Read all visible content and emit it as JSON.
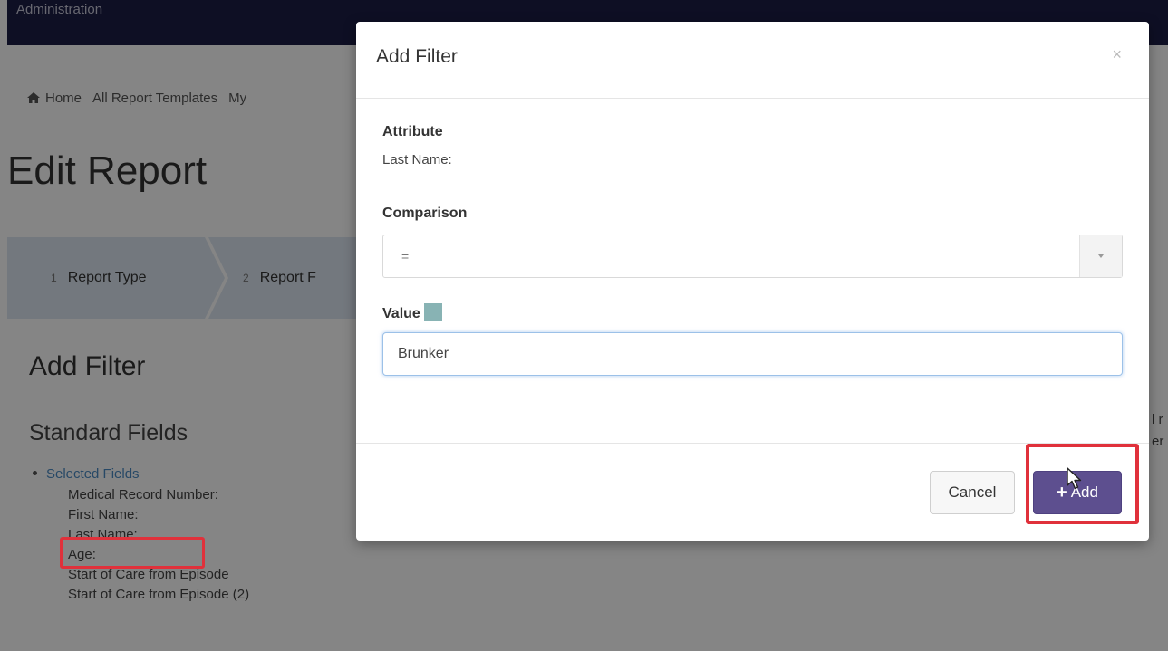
{
  "topbar": {
    "title": "Administration"
  },
  "breadcrumb": {
    "items": [
      {
        "label": "Home",
        "icon": "home-icon"
      },
      {
        "label": "All Report Templates"
      },
      {
        "label": "My"
      }
    ]
  },
  "page": {
    "title": "Edit Report"
  },
  "wizard": {
    "steps": [
      {
        "num": "1",
        "label": "Report Type"
      },
      {
        "num": "2",
        "label": "Report F"
      }
    ]
  },
  "filter_section": {
    "title": "Add Filter",
    "subtitle": "Standard Fields",
    "selected_label": "Selected Fields",
    "fields": [
      "Medical Record Number:",
      "First Name:",
      "Last Name:",
      "Age:",
      "Start of Care from Episode",
      "Start of Care from Episode (2)"
    ],
    "right_clip": [
      "l r",
      "er"
    ]
  },
  "modal": {
    "title": "Add Filter",
    "close_symbol": "×",
    "attribute_label": "Attribute",
    "attribute_value": "Last Name:",
    "comparison_label": "Comparison",
    "comparison_value": "=",
    "value_label": "Value",
    "value_input": "Brunker",
    "cancel_label": "Cancel",
    "add_label": "Add",
    "add_icon": "plus-icon"
  },
  "colors": {
    "topbar": "#1c1d45",
    "add_button": "#5d4f8f",
    "highlight": "#e0313b",
    "link": "#4b8bc4",
    "swatch": "#88b3b4"
  }
}
